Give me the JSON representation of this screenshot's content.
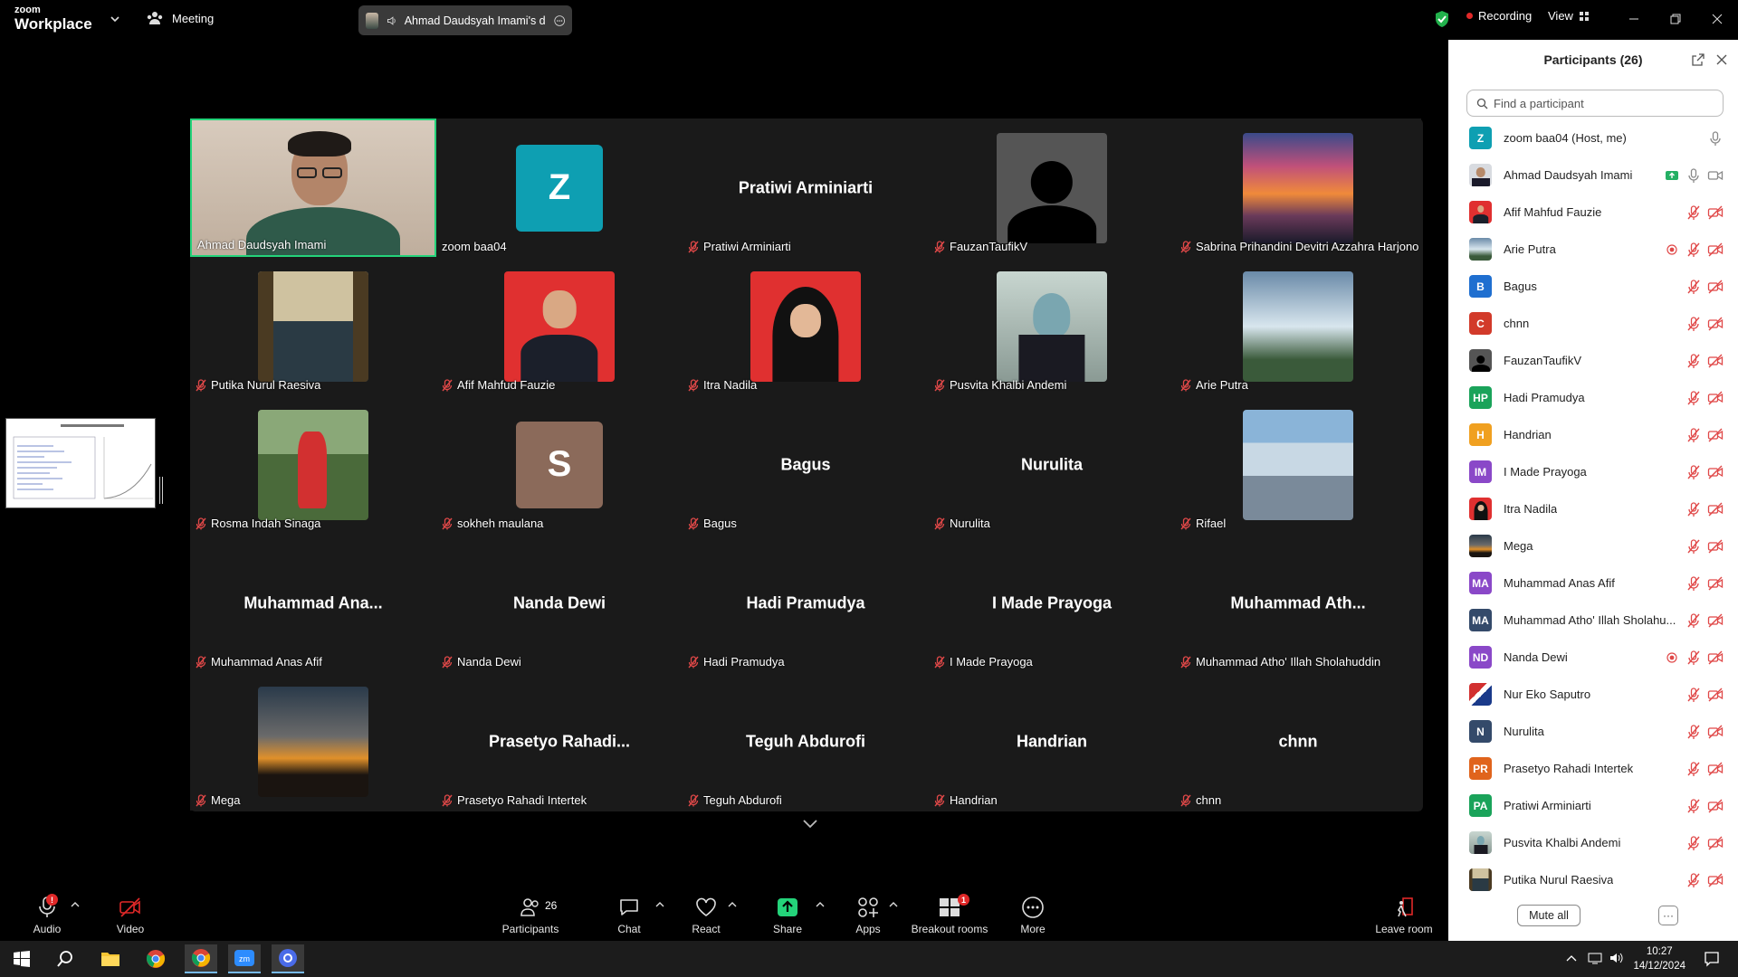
{
  "app": {
    "brand_small": "zoom",
    "brand": "Workplace",
    "meeting_label": "Meeting"
  },
  "speaking": {
    "text": "Ahmad Daudsyah Imami's d"
  },
  "topright": {
    "recording": "Recording",
    "view": "View"
  },
  "colors": {
    "active_speaker": "#24d37a",
    "recording": "#e02828",
    "shield": "#22b14c",
    "share": "#24d37a"
  },
  "tiles": [
    {
      "name": "Ahmad Daudsyah Imami",
      "kind": "video",
      "active": true,
      "muted": false
    },
    {
      "name": "zoom baa04",
      "kind": "letter",
      "letter": "Z",
      "color": "#0e9fb2",
      "muted": false
    },
    {
      "name": "Pratiwi Arminiarti",
      "kind": "text",
      "display": "Pratiwi Arminiarti",
      "muted": true
    },
    {
      "name": "FauzanTaufikV",
      "kind": "photo",
      "photo": "default-avatar",
      "muted": true
    },
    {
      "name": "Sabrina Prihandini Devitri Azzahra Harjono",
      "kind": "photo",
      "photo": "sunset",
      "muted": true
    },
    {
      "name": "Putika Nurul Raesiva",
      "kind": "photo",
      "photo": "window-sea",
      "muted": true
    },
    {
      "name": "Afif Mahfud Fauzie",
      "kind": "photo",
      "photo": "portrait-red",
      "muted": true
    },
    {
      "name": "Itra Nadila",
      "kind": "photo",
      "photo": "hijab-red",
      "muted": true
    },
    {
      "name": "Pusvita Khalbi Andemi",
      "kind": "photo",
      "photo": "graduate",
      "muted": true
    },
    {
      "name": "Arie Putra",
      "kind": "photo",
      "photo": "anime-sky",
      "muted": true
    },
    {
      "name": "Rosma Indah Sinaga",
      "kind": "photo",
      "photo": "park-path",
      "muted": true
    },
    {
      "name": "sokheh maulana",
      "kind": "letter",
      "letter": "S",
      "color": "#8b6a5a",
      "muted": true
    },
    {
      "name": "Bagus",
      "kind": "text",
      "display": "Bagus",
      "muted": true
    },
    {
      "name": "Nurulita",
      "kind": "text",
      "display": "Nurulita",
      "muted": true
    },
    {
      "name": "Rifael",
      "kind": "photo",
      "photo": "rocks",
      "muted": true
    },
    {
      "name": "Muhammad Anas Afif",
      "kind": "text",
      "display": "Muhammad  Ana...",
      "muted": true
    },
    {
      "name": "Nanda Dewi",
      "kind": "text",
      "display": "Nanda Dewi",
      "muted": true
    },
    {
      "name": "Hadi Pramudya",
      "kind": "text",
      "display": "Hadi Pramudya",
      "muted": true
    },
    {
      "name": "I Made Prayoga",
      "kind": "text",
      "display": "I Made Prayoga",
      "muted": true
    },
    {
      "name": "Muhammad Atho' Illah Sholahuddin",
      "kind": "text",
      "display": "Muhammad  Ath...",
      "muted": true
    },
    {
      "name": "Mega",
      "kind": "photo",
      "photo": "dusk",
      "muted": true
    },
    {
      "name": "Prasetyo Rahadi Intertek",
      "kind": "text",
      "display": "Prasetyo  Rahadi...",
      "muted": true
    },
    {
      "name": "Teguh Abdurofi",
      "kind": "text",
      "display": "Teguh Abdurofi",
      "muted": true
    },
    {
      "name": "Handrian",
      "kind": "text",
      "display": "Handrian",
      "muted": true
    },
    {
      "name": "chnn",
      "kind": "text",
      "display": "chnn",
      "muted": true
    }
  ],
  "panel": {
    "title": "Participants",
    "count": "(26)",
    "search_placeholder": "Find a participant",
    "mute_all": "Mute all",
    "more": "···",
    "participants": [
      {
        "name": "zoom baa04 (Host, me)",
        "initials": "Z",
        "color": "#0e9fb2",
        "icons": [
          "mic"
        ]
      },
      {
        "name": "Ahmad Daudsyah Imami",
        "photo": "man",
        "icons": [
          "share",
          "mic",
          "video"
        ]
      },
      {
        "name": "Afif Mahfud Fauzie",
        "photo": "portrait-red",
        "icons": [
          "mic-off",
          "video-off"
        ]
      },
      {
        "name": "Arie Putra",
        "photo": "anime-sky",
        "icons": [
          "rec",
          "mic-off",
          "video-off"
        ]
      },
      {
        "name": "Bagus",
        "initials": "B",
        "color": "#1f6fd0",
        "icons": [
          "mic-off",
          "video-off"
        ]
      },
      {
        "name": "chnn",
        "initials": "C",
        "color": "#d23a2a",
        "icons": [
          "mic-off",
          "video-off"
        ]
      },
      {
        "name": "FauzanTaufikV",
        "photo": "default-avatar",
        "icons": [
          "mic-off",
          "video-off"
        ]
      },
      {
        "name": "Hadi Pramudya",
        "initials": "HP",
        "color": "#1aa35a",
        "icons": [
          "mic-off",
          "video-off"
        ]
      },
      {
        "name": "Handrian",
        "initials": "H",
        "color": "#f0a020",
        "icons": [
          "mic-off",
          "video-off"
        ]
      },
      {
        "name": "I Made Prayoga",
        "initials": "IM",
        "color": "#8a48c8",
        "icons": [
          "mic-off",
          "video-off"
        ]
      },
      {
        "name": "Itra Nadila",
        "photo": "hijab-red",
        "icons": [
          "mic-off",
          "video-off"
        ]
      },
      {
        "name": "Mega",
        "photo": "dusk",
        "icons": [
          "mic-off",
          "video-off"
        ]
      },
      {
        "name": "Muhammad Anas Afif",
        "initials": "MA",
        "color": "#8a48c8",
        "icons": [
          "mic-off",
          "video-off"
        ]
      },
      {
        "name": "Muhammad Atho' Illah Sholahu...",
        "initials": "MA",
        "color": "#344a6a",
        "icons": [
          "mic-off",
          "video-off"
        ]
      },
      {
        "name": "Nanda Dewi",
        "initials": "ND",
        "color": "#8a48c8",
        "icons": [
          "rec",
          "mic-off",
          "video-off"
        ]
      },
      {
        "name": "Nur Eko Saputro",
        "photo": "flag",
        "icons": [
          "mic-off",
          "video-off"
        ]
      },
      {
        "name": "Nurulita",
        "initials": "N",
        "color": "#344a6a",
        "icons": [
          "mic-off",
          "video-off"
        ]
      },
      {
        "name": "Prasetyo Rahadi Intertek",
        "initials": "PR",
        "color": "#e0641c",
        "icons": [
          "mic-off",
          "video-off"
        ]
      },
      {
        "name": "Pratiwi Arminiarti",
        "initials": "PA",
        "color": "#1aa35a",
        "icons": [
          "mic-off",
          "video-off"
        ]
      },
      {
        "name": "Pusvita Khalbi Andemi",
        "photo": "graduate",
        "icons": [
          "mic-off",
          "video-off"
        ]
      },
      {
        "name": "Putika Nurul Raesiva",
        "photo": "window-sea",
        "icons": [
          "mic-off",
          "video-off"
        ]
      }
    ]
  },
  "toolbar": {
    "audio": "Audio",
    "video": "Video",
    "participants": "Participants",
    "participants_count": "26",
    "chat": "Chat",
    "react": "React",
    "share": "Share",
    "apps": "Apps",
    "breakout": "Breakout rooms",
    "breakout_badge": "1",
    "more": "More",
    "leave": "Leave room"
  },
  "taskbar": {
    "time": "10:27",
    "date": "14/12/2024"
  }
}
